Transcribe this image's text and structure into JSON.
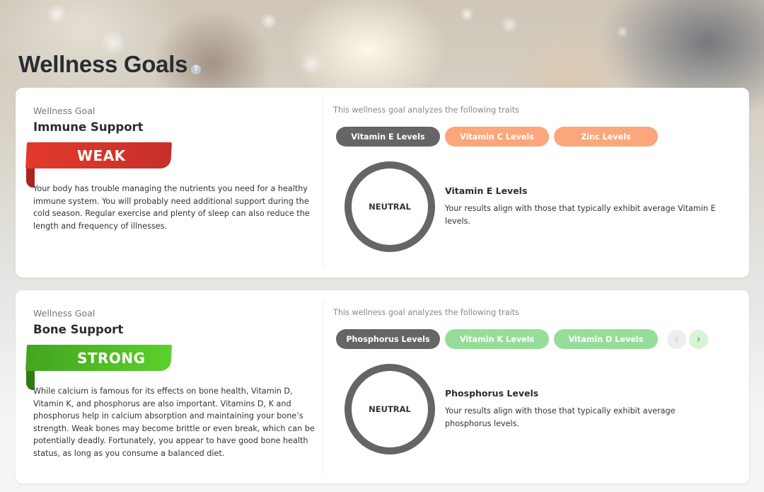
{
  "page": {
    "title": "Wellness Goals",
    "help_icon": "question-circle-icon",
    "help_glyph": "?"
  },
  "goals": [
    {
      "kicker": "Wellness Goal",
      "name": "Immune Support",
      "rating": "WEAK",
      "rating_color": "#d9352b",
      "description": "Your body has trouble managing the nutrients you need for a healthy immune system. You will probably need additional support during the cold season. Regular exercise and plenty of sleep can also reduce the length and frequency of illnesses.",
      "traits_label": "This wellness goal analyzes the following traits",
      "traits": [
        {
          "label": "Vitamin E Levels",
          "active": true
        },
        {
          "label": "Vitamin C Levels",
          "active": false
        },
        {
          "label": "Zinc Levels",
          "active": false
        }
      ],
      "trait_color": "#fca67b",
      "selected_result": {
        "status": "NEUTRAL",
        "title": "Vitamin E Levels",
        "description": "Your results align with those that typically exhibit average Vitamin E levels."
      }
    },
    {
      "kicker": "Wellness Goal",
      "name": "Bone Support",
      "rating": "STRONG",
      "rating_color": "#4fbf26",
      "description": "While calcium is famous for its effects on bone health, Vitamin D, Vitamin K, and phosphorus are also important. Vitamins D, K and phosphorus help in calcium absorption and maintaining your bone’s strength. Weak bones may become brittle or even break, which can be potentially deadly. Fortunately, you appear to have good bone health status, as long as you consume a balanced diet.",
      "traits_label": "This wellness goal analyzes the following traits",
      "traits": [
        {
          "label": "Phosphorus Levels",
          "active": true
        },
        {
          "label": "Vitamin K Levels",
          "active": false
        },
        {
          "label": "Vitamin D Levels",
          "active": false
        }
      ],
      "trait_color": "#97dd9a",
      "carousel": {
        "prev_icon": "chevron-left-icon",
        "prev_glyph": "‹",
        "next_icon": "chevron-right-icon",
        "next_glyph": "›"
      },
      "selected_result": {
        "status": "NEUTRAL",
        "title": "Phosphorus Levels",
        "description": "Your results align with those that typically exhibit average phosphorus levels."
      }
    }
  ],
  "colors": {
    "active_trait": "#656565",
    "ring": "#656565"
  }
}
